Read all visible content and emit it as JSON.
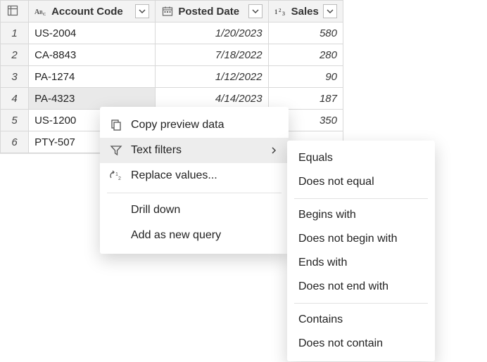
{
  "columns": {
    "account": "Account Code",
    "posted": "Posted Date",
    "sales": "Sales"
  },
  "rows": [
    {
      "n": "1",
      "acct": "US-2004",
      "date": "1/20/2023",
      "sales": "580"
    },
    {
      "n": "2",
      "acct": "CA-8843",
      "date": "7/18/2022",
      "sales": "280"
    },
    {
      "n": "3",
      "acct": "PA-1274",
      "date": "1/12/2022",
      "sales": "90"
    },
    {
      "n": "4",
      "acct": "PA-4323",
      "date": "4/14/2023",
      "sales": "187"
    },
    {
      "n": "5",
      "acct": "US-1200",
      "date": "",
      "sales": "350"
    },
    {
      "n": "6",
      "acct": "PTY-507",
      "date": "",
      "sales": ""
    }
  ],
  "selected_row_index": 3,
  "context_menu": {
    "copy": "Copy preview data",
    "text_filters": "Text filters",
    "replace": "Replace values...",
    "drill": "Drill down",
    "addq": "Add as new query"
  },
  "text_filters_submenu": {
    "equals": "Equals",
    "not_equal": "Does not equal",
    "begins": "Begins with",
    "not_begin": "Does not begin with",
    "ends": "Ends with",
    "not_end": "Does not end with",
    "contains": "Contains",
    "not_contains": "Does not contain"
  }
}
